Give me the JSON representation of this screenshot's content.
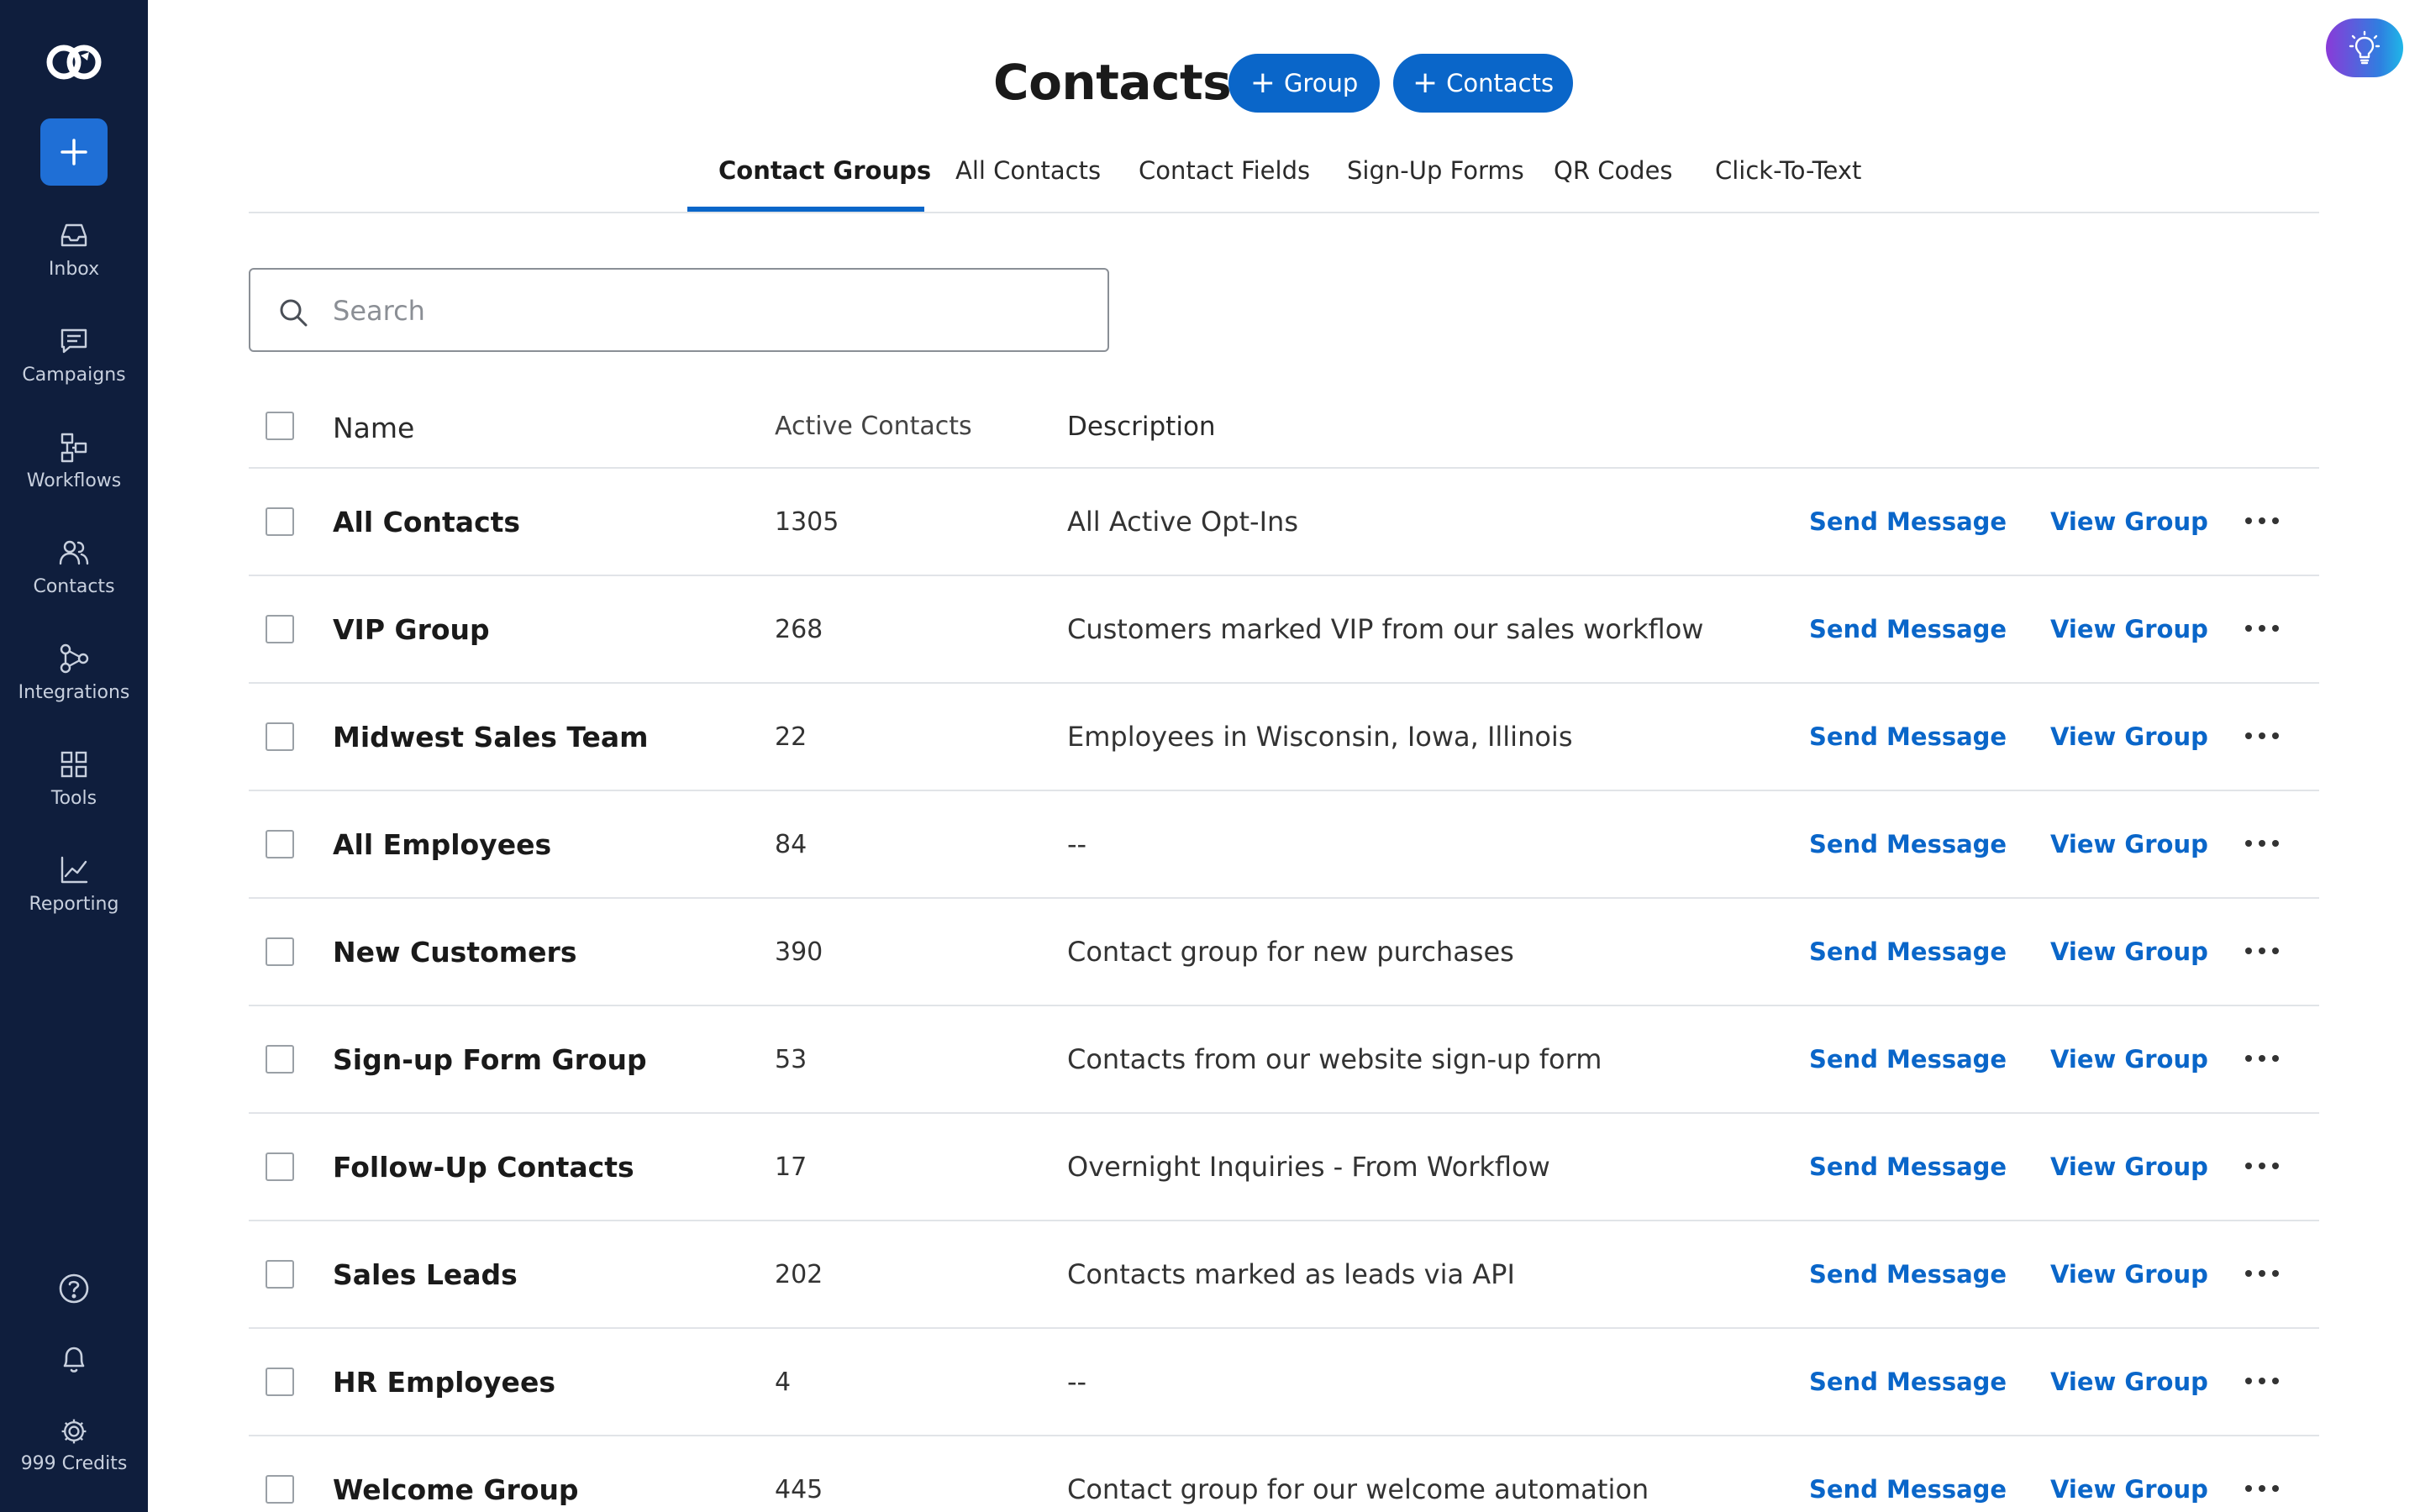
{
  "sidebar": {
    "logo": "sync-logo-icon",
    "compose_icon": "plus-icon",
    "items": [
      {
        "label": "Inbox",
        "icon": "inbox-icon"
      },
      {
        "label": "Campaigns",
        "icon": "chat-bubble-icon"
      },
      {
        "label": "Workflows",
        "icon": "workflow-icon"
      },
      {
        "label": "Contacts",
        "icon": "users-icon"
      },
      {
        "label": "Integrations",
        "icon": "share-nodes-icon"
      },
      {
        "label": "Tools",
        "icon": "grid-icon"
      },
      {
        "label": "Reporting",
        "icon": "line-chart-icon"
      }
    ],
    "bottom": {
      "help_icon": "help-circle-icon",
      "notifications_icon": "bell-icon",
      "settings_icon": "gear-icon",
      "credits_label": "999 Credits"
    }
  },
  "header": {
    "title": "Contacts",
    "add_group_label": "Group",
    "add_contacts_label": "Contacts",
    "plus_glyph": "+",
    "tips_icon": "lightbulb-icon"
  },
  "tabs": [
    {
      "label": "Contact Groups",
      "active": true
    },
    {
      "label": "All Contacts",
      "active": false
    },
    {
      "label": "Contact Fields",
      "active": false
    },
    {
      "label": "Sign-Up Forms",
      "active": false
    },
    {
      "label": "QR Codes",
      "active": false
    },
    {
      "label": "Click-To-Text",
      "active": false
    }
  ],
  "search": {
    "placeholder": "Search",
    "value": ""
  },
  "table": {
    "columns": {
      "name": "Name",
      "active_contacts": "Active Contacts",
      "description": "Description"
    },
    "row_actions": {
      "send": "Send Message",
      "view": "View Group"
    },
    "rows": [
      {
        "name": "All Contacts",
        "active": "1305",
        "description": "All Active Opt-Ins"
      },
      {
        "name": "VIP Group",
        "active": "268",
        "description": "Customers marked VIP from our sales workflow"
      },
      {
        "name": "Midwest Sales Team",
        "active": "22",
        "description": "Employees in Wisconsin, Iowa, Illinois"
      },
      {
        "name": "All Employees",
        "active": "84",
        "description": "--"
      },
      {
        "name": "New Customers",
        "active": "390",
        "description": "Contact group for new purchases"
      },
      {
        "name": "Sign-up Form Group",
        "active": "53",
        "description": "Contacts from our website sign-up form"
      },
      {
        "name": "Follow-Up Contacts",
        "active": "17",
        "description": "Overnight Inquiries - From Workflow"
      },
      {
        "name": "Sales Leads",
        "active": "202",
        "description": "Contacts marked as leads via API"
      },
      {
        "name": "HR Employees",
        "active": "4",
        "description": "--"
      },
      {
        "name": "Welcome Group",
        "active": "445",
        "description": "Contact group for our welcome automation"
      }
    ]
  },
  "colors": {
    "sidebar_bg": "#0f1e3d",
    "accent": "#0a66c9",
    "compose_bg": "#1f6fd6"
  }
}
